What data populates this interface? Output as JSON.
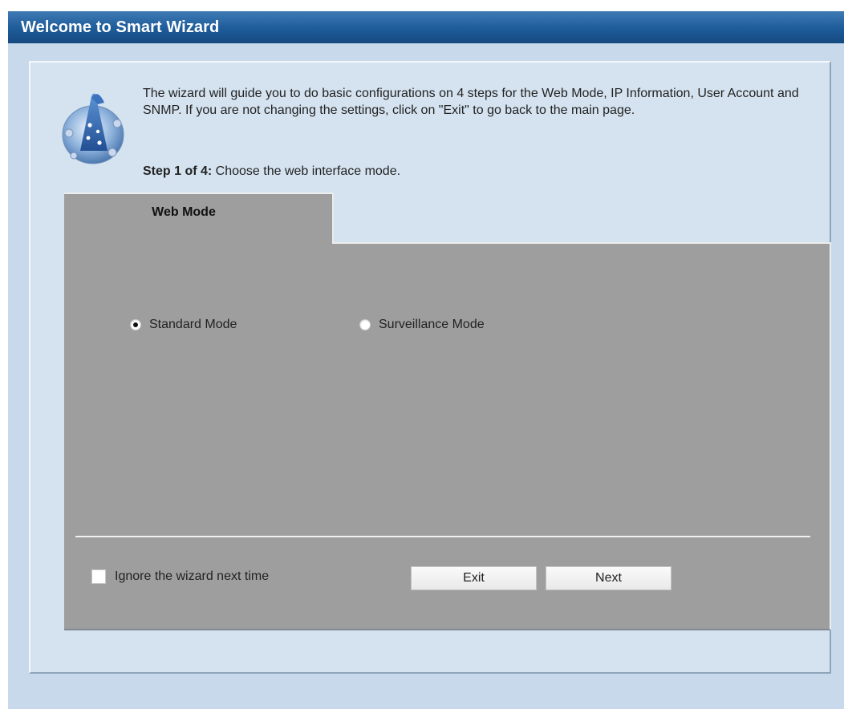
{
  "window": {
    "title": "Welcome to Smart Wizard"
  },
  "intro": {
    "text": "The wizard will guide you to do basic configurations on 4 steps for the Web Mode, IP Information, User Account and SNMP. If you are not changing the settings, click on \"Exit\" to go back to the main page.",
    "icon": "wizard-icon"
  },
  "step": {
    "prefix": "Step 1 of 4:",
    "text": " Choose the web interface mode."
  },
  "tab": {
    "label": "Web Mode"
  },
  "modes": {
    "standard": {
      "label": "Standard Mode",
      "checked": true
    },
    "surveillance": {
      "label": "Surveillance Mode",
      "checked": false
    }
  },
  "footer": {
    "ignore_label": "Ignore the wizard next time",
    "ignore_checked": false,
    "exit_label": "Exit",
    "next_label": "Next"
  },
  "colors": {
    "title_bar": "#1d5b99",
    "panel_bg": "#c7d9eb",
    "tab_bg": "#9e9e9e"
  }
}
